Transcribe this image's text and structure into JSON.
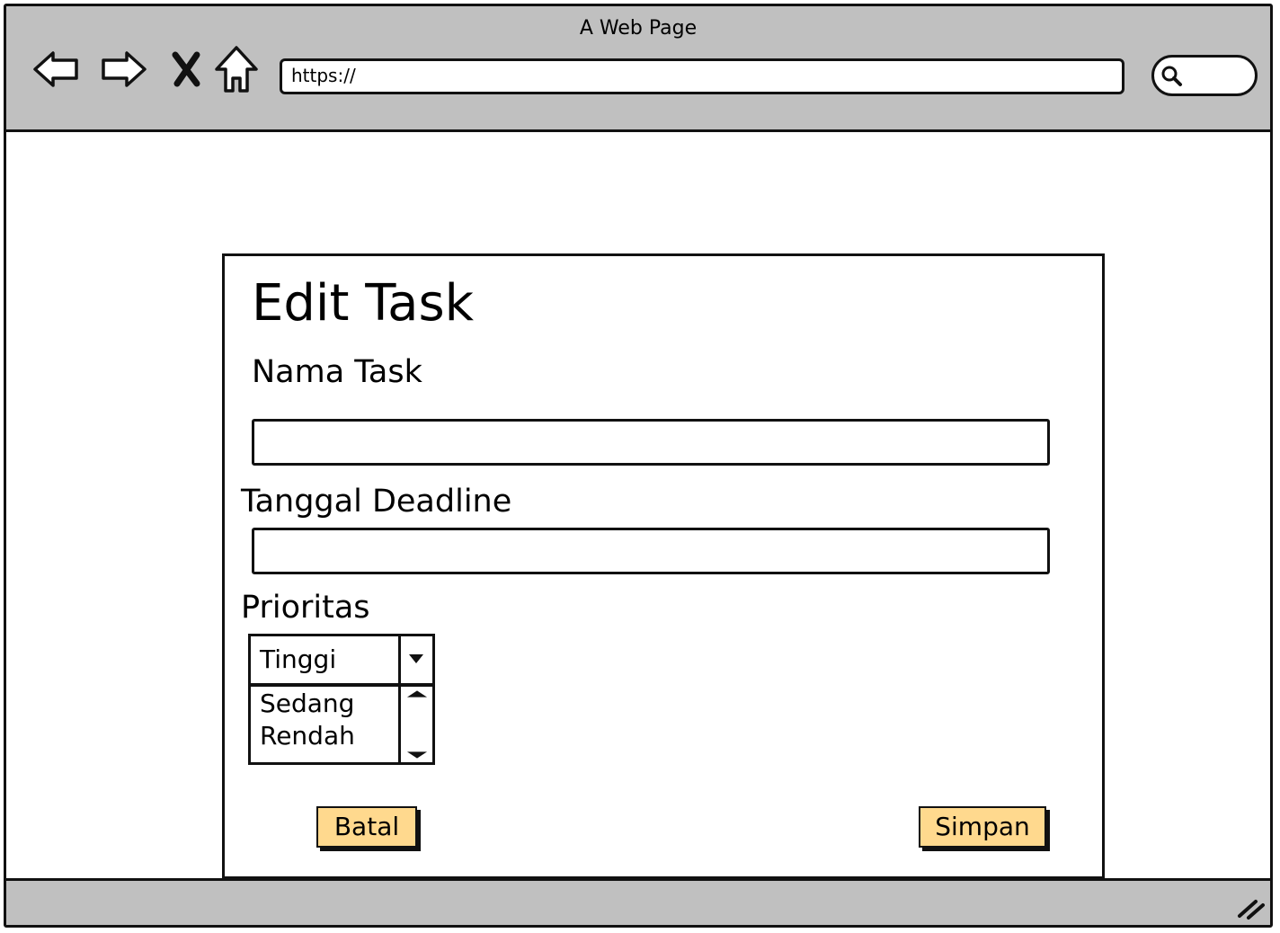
{
  "window": {
    "title": "A Web Page",
    "url": "https://"
  },
  "icons": {
    "back": "back-arrow-icon",
    "forward": "forward-arrow-icon",
    "close": "close-x-icon",
    "home": "home-icon",
    "search": "search-icon",
    "resize": "resize-grip-icon"
  },
  "form": {
    "title": "Edit Task",
    "name_label": "Nama Task",
    "name_value": "",
    "deadline_label": "Tanggal Deadline",
    "deadline_value": "",
    "priority_label": "Prioritas",
    "priority_selected": "Tinggi",
    "priority_options": [
      "Sedang",
      "Rendah"
    ],
    "cancel_label": "Batal",
    "save_label": "Simpan"
  },
  "colors": {
    "chrome": "#c0c0c0",
    "button": "#ffd98e"
  }
}
